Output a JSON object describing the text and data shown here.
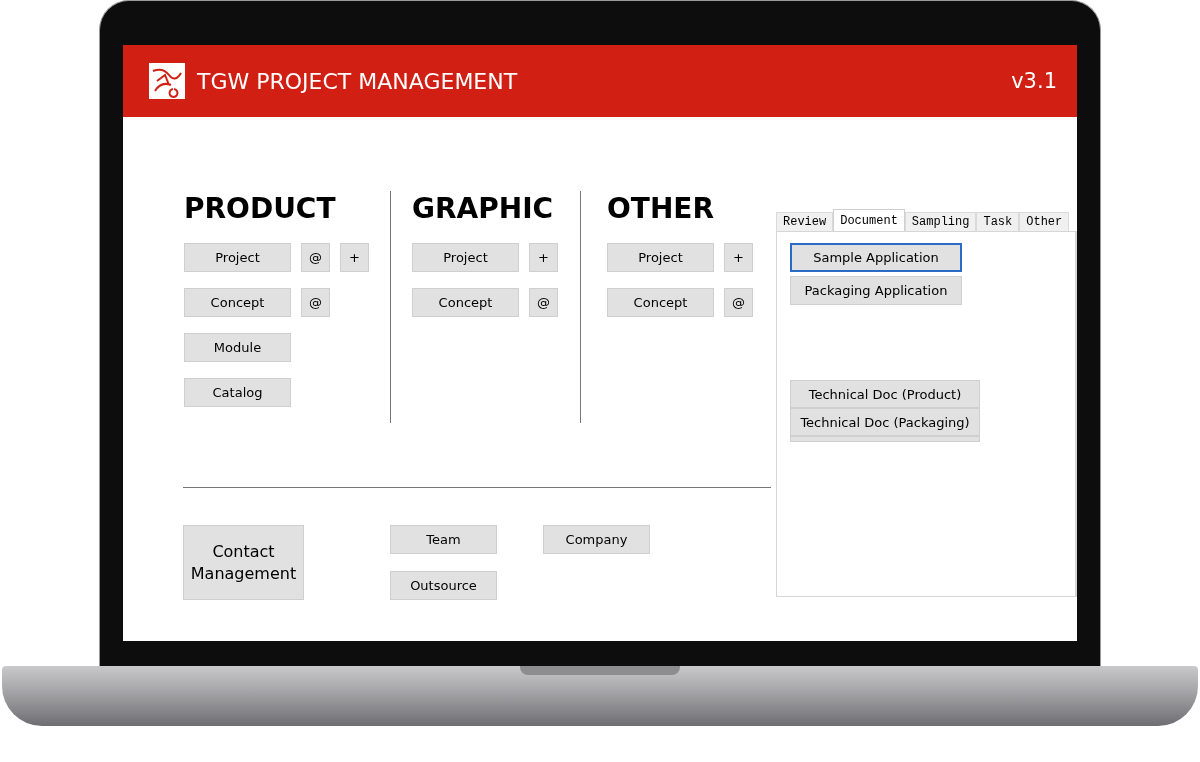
{
  "header": {
    "title": "TGW PROJECT MANAGEMENT",
    "version": "v3.1"
  },
  "sections": [
    {
      "title": "PRODUCT",
      "rows": [
        [
          {
            "label": "Project",
            "kind": "wide"
          },
          {
            "label": "@",
            "kind": "small"
          },
          {
            "label": "+",
            "kind": "small"
          }
        ],
        [
          {
            "label": "Concept",
            "kind": "wide"
          },
          {
            "label": "@",
            "kind": "small"
          }
        ],
        [
          {
            "label": "Module",
            "kind": "wide"
          }
        ],
        [
          {
            "label": "Catalog",
            "kind": "wide"
          }
        ]
      ]
    },
    {
      "title": "GRAPHIC",
      "rows": [
        [
          {
            "label": "Project",
            "kind": "wide"
          },
          {
            "label": "+",
            "kind": "small"
          }
        ],
        [
          {
            "label": "Concept",
            "kind": "wide"
          },
          {
            "label": "@",
            "kind": "small"
          }
        ]
      ]
    },
    {
      "title": "OTHER",
      "rows": [
        [
          {
            "label": "Project",
            "kind": "wide"
          },
          {
            "label": "+",
            "kind": "small"
          }
        ],
        [
          {
            "label": "Concept",
            "kind": "wide"
          },
          {
            "label": "@",
            "kind": "small"
          }
        ]
      ]
    }
  ],
  "contacts": {
    "main": "Contact Management",
    "buttons": [
      {
        "label": "Team"
      },
      {
        "label": "Company"
      },
      {
        "label": "Outsource"
      }
    ]
  },
  "tabs": [
    {
      "label": "Review",
      "selected": false
    },
    {
      "label": "Document",
      "selected": true
    },
    {
      "label": "Sampling",
      "selected": false
    },
    {
      "label": "Task",
      "selected": false
    },
    {
      "label": "Other",
      "selected": false
    }
  ],
  "document_pane": {
    "groups": [
      [
        {
          "label": "Sample Application",
          "focused": true
        },
        {
          "label": "Packaging Application",
          "focused": false
        }
      ],
      [
        {
          "label": "Technical Doc (Product)",
          "focused": false
        },
        {
          "label": "Technical Doc (Packaging)",
          "focused": false
        }
      ]
    ]
  }
}
